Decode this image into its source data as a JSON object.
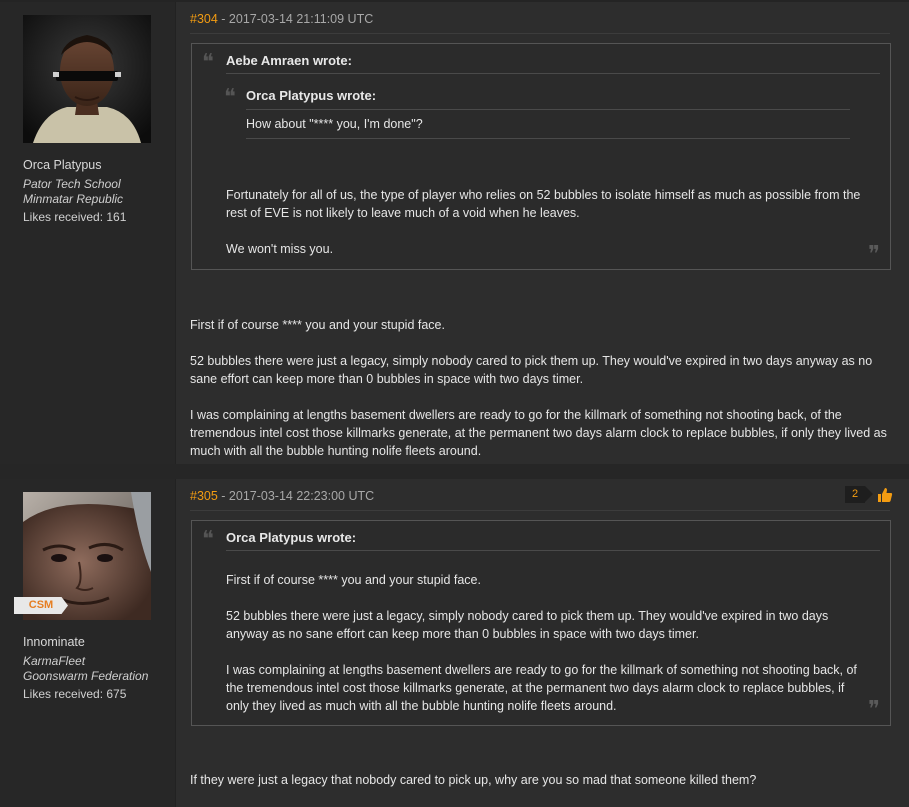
{
  "posts": [
    {
      "number": "#304",
      "timestamp": "- 2017-03-14 21:11:09 UTC",
      "author": {
        "name": "Orca Platypus",
        "corp": "Pator Tech School",
        "alliance": "Minmatar Republic",
        "likes": "Likes received: 161"
      },
      "quote": {
        "author": "Aebe Amraen wrote:",
        "nested": {
          "author": "Orca Platypus wrote:",
          "text": "How about \"**** you, I'm done\"?"
        },
        "paragraphs": [
          "Fortunately for all of us, the type of player who relies on 52 bubbles to isolate himself as much as possible from the rest of EVE is not likely to leave much of a void when he leaves.",
          "We won't miss you."
        ]
      },
      "paragraphs": [
        "First if of course **** you and your stupid face.",
        "52 bubbles there were just a legacy, simply nobody cared to pick them up. They would've expired in two days anyway as no sane effort can keep more than 0 bubbles in space with two days timer.",
        "I was complaining at lengths basement dwellers are ready to go for the killmark of something not shooting back, of the tremendous intel cost those killmarks generate, at the permanent two days alarm clock to replace bubbles, if only they lived as much with all the bubble hunting nolife fleets around."
      ]
    },
    {
      "number": "#305",
      "timestamp": "- 2017-03-14 22:23:00 UTC",
      "likes_count": "2",
      "author": {
        "name": "Innominate",
        "badge": "CSM",
        "corp": "KarmaFleet",
        "alliance": "Goonswarm Federation",
        "likes": "Likes received: 675"
      },
      "quote": {
        "author": "Orca Platypus wrote:",
        "paragraphs": [
          "First if of course **** you and your stupid face.",
          "52 bubbles there were just a legacy, simply nobody cared to pick them up. They would've expired in two days anyway as no sane effort can keep more than 0 bubbles in space with two days timer.",
          "I was complaining at lengths basement dwellers are ready to go for the killmark of something not shooting back, of the tremendous intel cost those killmarks generate, at the permanent two days alarm clock to replace bubbles, if only they lived as much with all the bubble hunting nolife fleets around."
        ]
      },
      "paragraphs": [
        "If they were just a legacy that nobody cared to pick up, why are you so mad that someone killed them?"
      ]
    }
  ],
  "icons": {
    "like": "thumbs-up-icon",
    "quote_open": "quote-open-icon",
    "quote_close": "quote-close-icon"
  },
  "colors": {
    "accent": "#f39c12",
    "background": "#2d2d2d",
    "sidebar": "#272727"
  }
}
